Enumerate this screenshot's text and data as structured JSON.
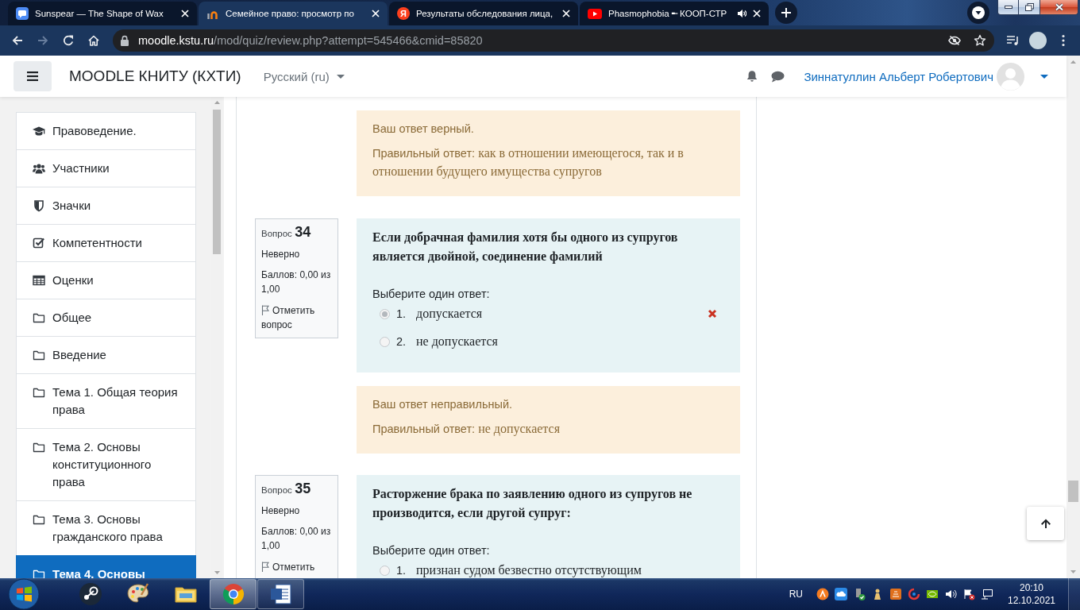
{
  "browser": {
    "tabs": [
      {
        "title": "Sunspear — The Shape of Wax",
        "selected": false,
        "audio": false
      },
      {
        "title": "Семейное право: просмотр по",
        "selected": true,
        "audio": false
      },
      {
        "title": "Результаты обследования лица,",
        "favicon_text": "Я",
        "selected": false,
        "audio": false
      },
      {
        "title": "Phasmophobia ╾ КООП-СТР",
        "selected": false,
        "audio": true
      }
    ],
    "nav_buttons": [
      {
        "kind": "back",
        "disabled": false
      },
      {
        "kind": "forward",
        "disabled": true
      },
      {
        "kind": "reload",
        "disabled": false
      },
      {
        "kind": "home",
        "disabled": false
      }
    ],
    "address": {
      "host": "moodle.kstu.ru",
      "path": "/mod/quiz/review.php?attempt=545466&cmid=85820"
    }
  },
  "navbar": {
    "site_name": "MOODLE КНИТУ (КХТИ)",
    "language": "Русский (ru)",
    "user_name": "Зиннатуллин Альберт Робертович"
  },
  "sidebar": {
    "items": [
      {
        "label": "Правоведение.",
        "selected": false
      },
      {
        "label": "Участники",
        "selected": false
      },
      {
        "label": "Значки",
        "selected": false
      },
      {
        "label": "Компетентности",
        "selected": false
      },
      {
        "label": "Оценки",
        "selected": false
      },
      {
        "label": "Общее",
        "selected": false
      },
      {
        "label": "Введение",
        "selected": false
      },
      {
        "label": "Тема 1. Общая теория права",
        "selected": false
      },
      {
        "label": "Тема 2. Основы конституционного права",
        "selected": false
      },
      {
        "label": "Тема 3. Основы гражданского права",
        "selected": false
      },
      {
        "label": "Тема 4. Основы",
        "selected": true
      }
    ]
  },
  "quiz": {
    "questions": [
      {
        "feedback": {
          "verdict": "Ваш ответ верный.",
          "right_label": "Правильный ответ:",
          "right_answer": "как в отношении имеющегося, так и в отношении будущего имущества супругов"
        }
      },
      {
        "info": {
          "label": "Вопрос",
          "number": "34",
          "state": "Неверно",
          "grade": "Баллов: 0,00 из 1,00",
          "flag": "Отметить вопрос"
        },
        "formulation": {
          "text": "Если добрачная фамилия хотя бы одного из супругов является двойной, соединение фамилий",
          "prompt": "Выберите один ответ:",
          "answers": [
            {
              "number": "1.",
              "text": "допускается",
              "selected": true,
              "incorrect": true
            },
            {
              "number": "2.",
              "text": "не допускается",
              "selected": false,
              "incorrect": false
            }
          ]
        },
        "feedback": {
          "verdict": "Ваш ответ неправильный.",
          "right_label": "Правильный ответ:",
          "right_answer": "не допускается"
        }
      },
      {
        "info": {
          "label": "Вопрос",
          "number": "35",
          "state": "Неверно",
          "grade": "Баллов: 0,00 из 1,00",
          "flag": "Отметить"
        },
        "formulation": {
          "text": "Расторжение брака по заявлению одного из супругов не производится, если другой супруг:",
          "prompt": "Выберите один ответ:",
          "answers": [
            {
              "number": "1.",
              "text": "признан судом безвестно отсутствующим",
              "selected": false,
              "incorrect": false
            }
          ]
        }
      }
    ]
  },
  "taskbar": {
    "apps": [
      {
        "kind": "steam",
        "running": false,
        "selected": false
      },
      {
        "kind": "paint",
        "running": false,
        "selected": false
      },
      {
        "kind": "explorer",
        "running": false,
        "selected": false
      },
      {
        "kind": "chrome",
        "running": true,
        "selected": true
      },
      {
        "kind": "word",
        "running": true,
        "selected": false
      }
    ],
    "language": "RU",
    "tray": [
      {
        "kind": "circle"
      },
      {
        "kind": "cloud"
      },
      {
        "kind": "drive"
      },
      {
        "kind": "figure"
      },
      {
        "kind": "tile"
      },
      {
        "kind": "swirl"
      },
      {
        "kind": "eye"
      },
      {
        "kind": "speaker"
      },
      {
        "kind": "flag"
      },
      {
        "kind": "monitor"
      }
    ],
    "time": "20:10",
    "date": "12.10.2021"
  }
}
